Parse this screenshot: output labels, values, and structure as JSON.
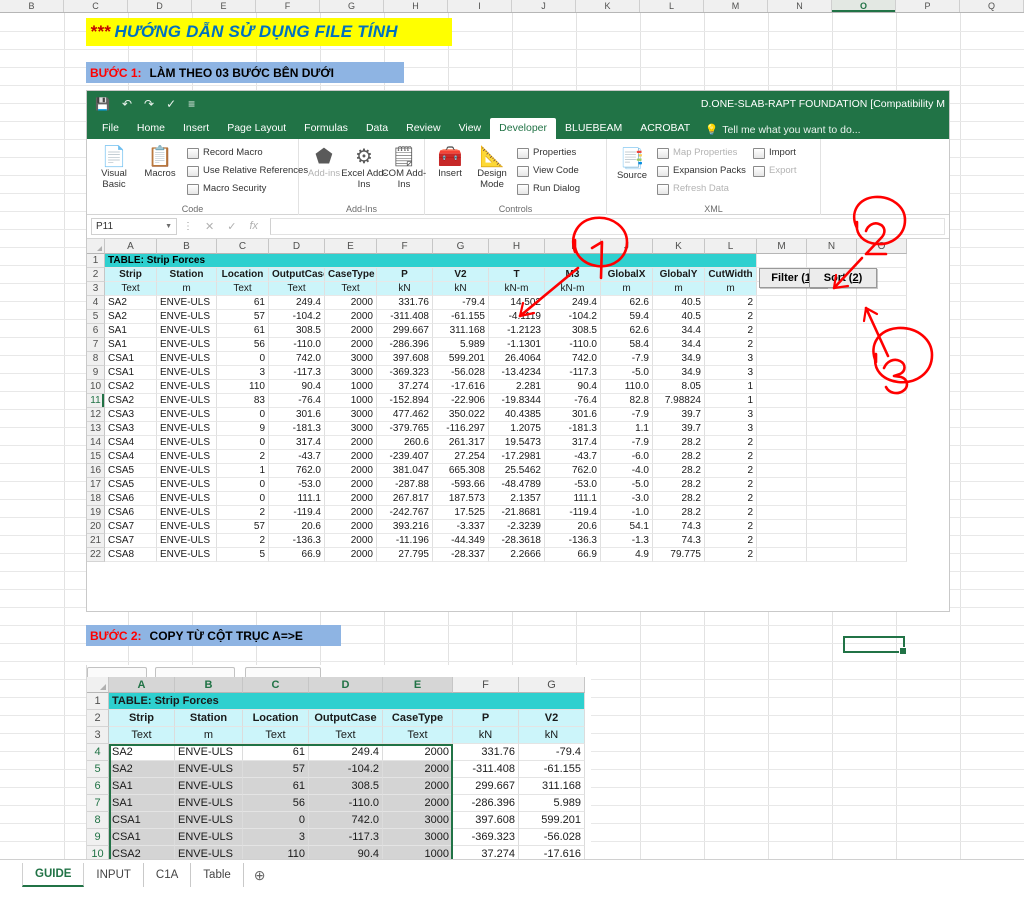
{
  "outer_sheet": {
    "column_headers": [
      "B",
      "C",
      "D",
      "E",
      "F",
      "G",
      "H",
      "I",
      "J",
      "K",
      "L",
      "M",
      "N",
      "O",
      "P",
      "Q"
    ],
    "selected_column": "O"
  },
  "guide": {
    "title_stars": "***",
    "title_text": "HƯỚNG DẪN SỬ DỤNG FILE TÍNH",
    "title_bg": "#ffff00",
    "title_color": "#0070c0",
    "step1_label": "BƯỚC 1:",
    "step1_text": "LÀM THEO 03 BƯỚC BÊN DƯỚI",
    "step2_label": "BƯỚC 2:",
    "step2_text": "COPY TỪ CỘT TRỤC A=>E",
    "band_bg": "#8eb4e3",
    "label_color": "#ff0000"
  },
  "excel": {
    "document_title": "D.ONE-SLAB-RAPT FOUNDATION  [Compatibility M",
    "quick_access": [
      "save-icon",
      "undo-icon",
      "redo-icon",
      "format-painter-icon",
      "customize-qat-icon"
    ],
    "ribbon_tabs": [
      {
        "label": "File",
        "active": false
      },
      {
        "label": "Home",
        "active": false
      },
      {
        "label": "Insert",
        "active": false
      },
      {
        "label": "Page Layout",
        "active": false
      },
      {
        "label": "Formulas",
        "active": false
      },
      {
        "label": "Data",
        "active": false
      },
      {
        "label": "Review",
        "active": false
      },
      {
        "label": "View",
        "active": false
      },
      {
        "label": "Developer",
        "active": true
      },
      {
        "label": "BLUEBEAM",
        "active": false
      },
      {
        "label": "ACROBAT",
        "active": false
      }
    ],
    "tell_me": "Tell me what you want to do...",
    "ribbon_groups": [
      {
        "name": "Code",
        "big_buttons": [
          {
            "label": "Visual Basic",
            "icon": "visual-basic-icon"
          },
          {
            "label": "Macros",
            "icon": "macros-icon"
          }
        ],
        "small_items": [
          {
            "label": "Record Macro",
            "icon": "record-macro-icon",
            "disabled": false
          },
          {
            "label": "Use Relative References",
            "icon": "relative-references-icon",
            "disabled": false
          },
          {
            "label": "Macro Security",
            "icon": "macro-security-icon",
            "disabled": false
          }
        ]
      },
      {
        "name": "Add-Ins",
        "big_buttons": [
          {
            "label": "Add-ins",
            "icon": "add-ins-icon"
          },
          {
            "label": "Excel Add-Ins",
            "icon": "excel-add-ins-icon"
          },
          {
            "label": "COM Add-Ins",
            "icon": "com-add-ins-icon"
          }
        ],
        "small_items": []
      },
      {
        "name": "Controls",
        "big_buttons": [
          {
            "label": "Insert",
            "icon": "insert-control-icon"
          },
          {
            "label": "Design Mode",
            "icon": "design-mode-icon"
          }
        ],
        "small_items": [
          {
            "label": "Properties",
            "icon": "properties-icon",
            "disabled": false
          },
          {
            "label": "View Code",
            "icon": "view-code-icon",
            "disabled": false
          },
          {
            "label": "Run Dialog",
            "icon": "run-dialog-icon",
            "disabled": false
          }
        ]
      },
      {
        "name": "XML",
        "big_buttons": [
          {
            "label": "Source",
            "icon": "xml-source-icon"
          }
        ],
        "small_items": [
          {
            "label": "Map Properties",
            "icon": "map-properties-icon",
            "disabled": true
          },
          {
            "label": "Expansion Packs",
            "icon": "expansion-packs-icon",
            "disabled": false
          },
          {
            "label": "Refresh Data",
            "icon": "refresh-data-icon",
            "disabled": true
          },
          {
            "label": "Import",
            "icon": "import-icon",
            "disabled": false
          },
          {
            "label": "Export",
            "icon": "export-icon",
            "disabled": true
          }
        ]
      }
    ],
    "formula_bar": {
      "name_box": "P11",
      "cancel_icon": "cancel-icon",
      "enter_icon": "confirm-icon",
      "fx_icon": "insert-function-icon",
      "formula_value": ""
    },
    "sheet_tabs": [
      {
        "label": "GUIDE",
        "active": true
      },
      {
        "label": "INPUT",
        "active": false
      },
      {
        "label": "C1A",
        "active": false
      },
      {
        "label": "Table",
        "active": false
      }
    ],
    "add_sheet_icon": "add-sheet-icon"
  },
  "table1": {
    "column_headers": [
      "A",
      "B",
      "C",
      "D",
      "E",
      "F",
      "G",
      "H",
      "I",
      "J",
      "K",
      "L",
      "M",
      "N",
      "O"
    ],
    "title": "TABLE:  Strip Forces",
    "headers": [
      "Strip",
      "Station",
      "Location",
      "OutputCase",
      "CaseType",
      "P",
      "V2",
      "T",
      "M3",
      "GlobalX",
      "GlobalY",
      "CutWidth"
    ],
    "units": [
      "Text",
      "m",
      "Text",
      "Text",
      "Text",
      "kN",
      "kN",
      "kN-m",
      "kN-m",
      "m",
      "m",
      "m"
    ],
    "row_numbers": [
      1,
      2,
      3,
      4,
      5,
      6,
      7,
      8,
      9,
      10,
      11,
      12,
      13,
      14,
      15,
      16,
      17,
      18,
      19,
      20,
      21,
      22
    ],
    "selected_row": 11,
    "rows": [
      [
        "SA2",
        "ENVE-ULS",
        "61",
        "249.4",
        "2000",
        "331.76",
        "-79.4",
        "14.502",
        "249.4",
        "62.6",
        "40.5",
        "2"
      ],
      [
        "SA2",
        "ENVE-ULS",
        "57",
        "-104.2",
        "2000",
        "-311.408",
        "-61.155",
        "-4.1119",
        "-104.2",
        "59.4",
        "40.5",
        "2"
      ],
      [
        "SA1",
        "ENVE-ULS",
        "61",
        "308.5",
        "2000",
        "299.667",
        "311.168",
        "-1.2123",
        "308.5",
        "62.6",
        "34.4",
        "2"
      ],
      [
        "SA1",
        "ENVE-ULS",
        "56",
        "-110.0",
        "2000",
        "-286.396",
        "5.989",
        "-1.1301",
        "-110.0",
        "58.4",
        "34.4",
        "2"
      ],
      [
        "CSA1",
        "ENVE-ULS",
        "0",
        "742.0",
        "3000",
        "397.608",
        "599.201",
        "26.4064",
        "742.0",
        "-7.9",
        "34.9",
        "3"
      ],
      [
        "CSA1",
        "ENVE-ULS",
        "3",
        "-117.3",
        "3000",
        "-369.323",
        "-56.028",
        "-13.4234",
        "-117.3",
        "-5.0",
        "34.9",
        "3"
      ],
      [
        "CSA2",
        "ENVE-ULS",
        "110",
        "90.4",
        "1000",
        "37.274",
        "-17.616",
        "2.281",
        "90.4",
        "110.0",
        "8.05",
        "1"
      ],
      [
        "CSA2",
        "ENVE-ULS",
        "83",
        "-76.4",
        "1000",
        "-152.894",
        "-22.906",
        "-19.8344",
        "-76.4",
        "82.8",
        "7.98824",
        "1"
      ],
      [
        "CSA3",
        "ENVE-ULS",
        "0",
        "301.6",
        "3000",
        "477.462",
        "350.022",
        "40.4385",
        "301.6",
        "-7.9",
        "39.7",
        "3"
      ],
      [
        "CSA3",
        "ENVE-ULS",
        "9",
        "-181.3",
        "3000",
        "-379.765",
        "-116.297",
        "1.2075",
        "-181.3",
        "1.1",
        "39.7",
        "3"
      ],
      [
        "CSA4",
        "ENVE-ULS",
        "0",
        "317.4",
        "2000",
        "260.6",
        "261.317",
        "19.5473",
        "317.4",
        "-7.9",
        "28.2",
        "2"
      ],
      [
        "CSA4",
        "ENVE-ULS",
        "2",
        "-43.7",
        "2000",
        "-239.407",
        "27.254",
        "-17.2981",
        "-43.7",
        "-6.0",
        "28.2",
        "2"
      ],
      [
        "CSA5",
        "ENVE-ULS",
        "1",
        "762.0",
        "2000",
        "381.047",
        "665.308",
        "25.5462",
        "762.0",
        "-4.0",
        "28.2",
        "2"
      ],
      [
        "CSA5",
        "ENVE-ULS",
        "0",
        "-53.0",
        "2000",
        "-287.88",
        "-593.66",
        "-48.4789",
        "-53.0",
        "-5.0",
        "28.2",
        "2"
      ],
      [
        "CSA6",
        "ENVE-ULS",
        "0",
        "111.1",
        "2000",
        "267.817",
        "187.573",
        "2.1357",
        "111.1",
        "-3.0",
        "28.2",
        "2"
      ],
      [
        "CSA6",
        "ENVE-ULS",
        "2",
        "-119.4",
        "2000",
        "-242.767",
        "17.525",
        "-21.8681",
        "-119.4",
        "-1.0",
        "28.2",
        "2"
      ],
      [
        "CSA7",
        "ENVE-ULS",
        "57",
        "20.6",
        "2000",
        "393.216",
        "-3.337",
        "-2.3239",
        "20.6",
        "54.1",
        "74.3",
        "2"
      ],
      [
        "CSA7",
        "ENVE-ULS",
        "2",
        "-136.3",
        "2000",
        "-11.196",
        "-44.349",
        "-28.3618",
        "-136.3",
        "-1.3",
        "74.3",
        "2"
      ],
      [
        "CSA8",
        "ENVE-ULS",
        "5",
        "66.9",
        "2000",
        "27.795",
        "-28.337",
        "2.2666",
        "66.9",
        "4.9",
        "79.775",
        "2"
      ]
    ]
  },
  "sheet_buttons": [
    {
      "label": "Filter (",
      "accel": "1",
      "suffix": ")",
      "name": "filter-button"
    },
    {
      "label": "Sort (",
      "accel": "2",
      "suffix": ")",
      "name": "sort-button"
    }
  ],
  "table2": {
    "column_headers": [
      "A",
      "B",
      "C",
      "D",
      "E",
      "F",
      "G"
    ],
    "selected_columns": [
      "A",
      "B",
      "C",
      "D",
      "E"
    ],
    "title": "TABLE:  Strip Forces",
    "headers": [
      "Strip",
      "Station",
      "Location",
      "OutputCase",
      "CaseType",
      "P",
      "V2"
    ],
    "units": [
      "Text",
      "m",
      "Text",
      "Text",
      "Text",
      "kN",
      "kN"
    ],
    "row_numbers": [
      1,
      2,
      3,
      4,
      5,
      6,
      7,
      8,
      9,
      10
    ],
    "rows": [
      [
        "SA2",
        "ENVE-ULS",
        "61",
        "249.4",
        "2000",
        "331.76",
        "-79.4"
      ],
      [
        "SA2",
        "ENVE-ULS",
        "57",
        "-104.2",
        "2000",
        "-311.408",
        "-61.155"
      ],
      [
        "SA1",
        "ENVE-ULS",
        "61",
        "308.5",
        "2000",
        "299.667",
        "311.168"
      ],
      [
        "SA1",
        "ENVE-ULS",
        "56",
        "-110.0",
        "2000",
        "-286.396",
        "5.989"
      ],
      [
        "CSA1",
        "ENVE-ULS",
        "0",
        "742.0",
        "3000",
        "397.608",
        "599.201"
      ],
      [
        "CSA1",
        "ENVE-ULS",
        "3",
        "-117.3",
        "3000",
        "-369.323",
        "-56.028"
      ],
      [
        "CSA2",
        "ENVE-ULS",
        "110",
        "90.4",
        "1000",
        "37.274",
        "-17.616"
      ]
    ]
  },
  "annotations": {
    "marks": [
      "1",
      "2",
      "3"
    ],
    "color": "#ff0000"
  }
}
